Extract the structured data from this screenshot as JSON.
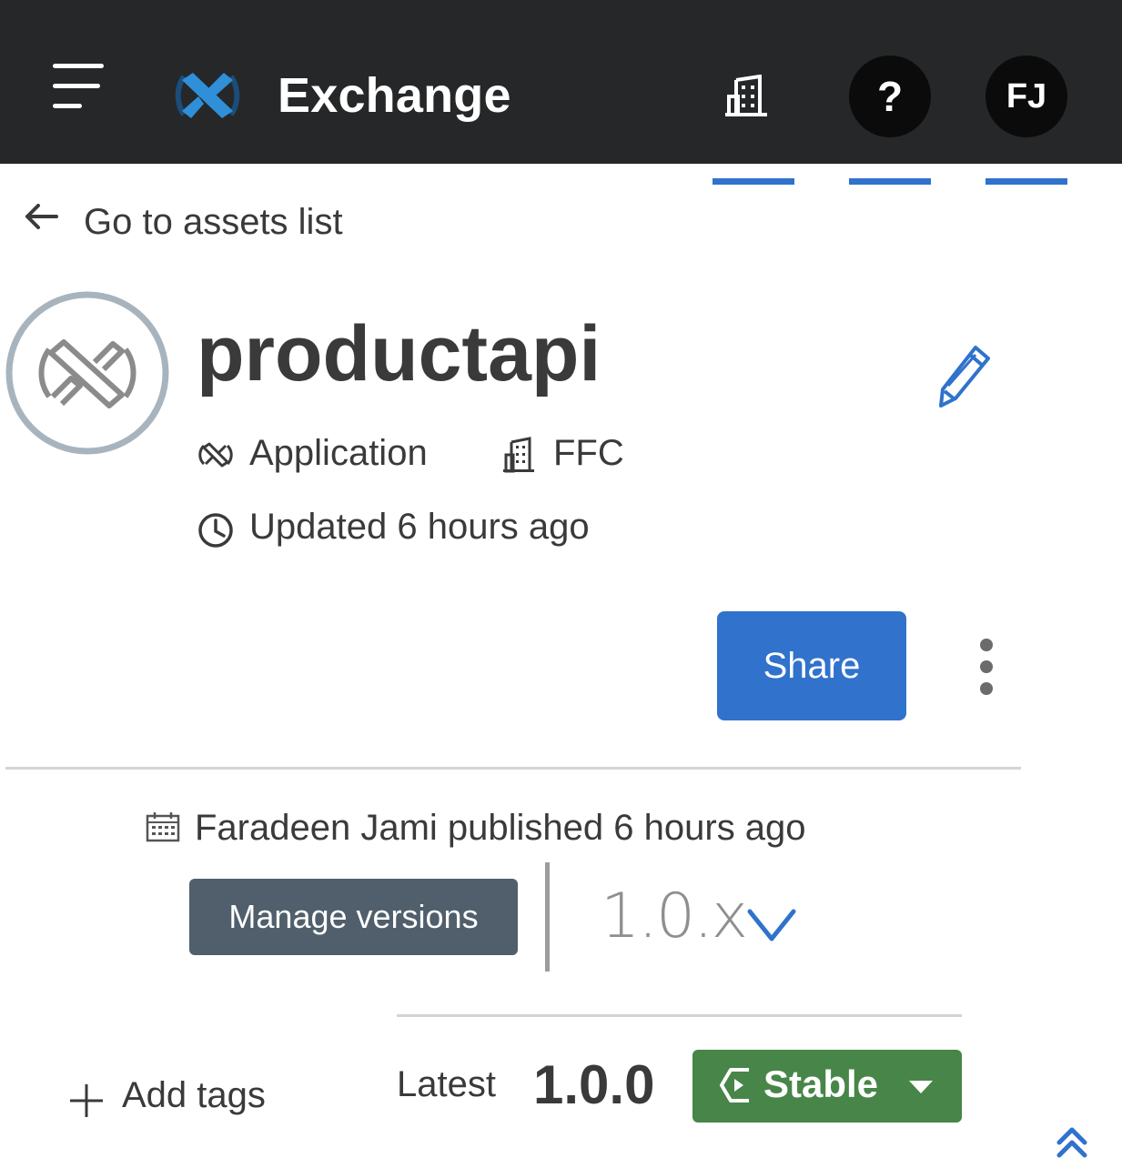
{
  "header": {
    "app_name": "Exchange",
    "help_label": "?",
    "user_initials": "FJ",
    "accent_color": "#3072cc",
    "background_color": "#262728",
    "icons": [
      "menu-icon",
      "exchange-logo-icon",
      "organization-icon"
    ]
  },
  "nav": {
    "back_label": "Go to assets list"
  },
  "asset": {
    "name": "productapi",
    "type": "Application",
    "organization": "FFC",
    "updated": "Updated 6 hours ago"
  },
  "actions": {
    "share_label": "Share",
    "share_color": "#3072cc"
  },
  "version_panel": {
    "published_text": "Faradeen Jami published 6 hours ago",
    "manage_versions_label": "Manage versions",
    "selected_version": "1.0.x",
    "latest_label": "Latest",
    "latest_version": "1.0.0",
    "lifecycle_label": "Stable",
    "lifecycle_color": "#478648"
  },
  "tags": {
    "add_label": "Add tags"
  }
}
